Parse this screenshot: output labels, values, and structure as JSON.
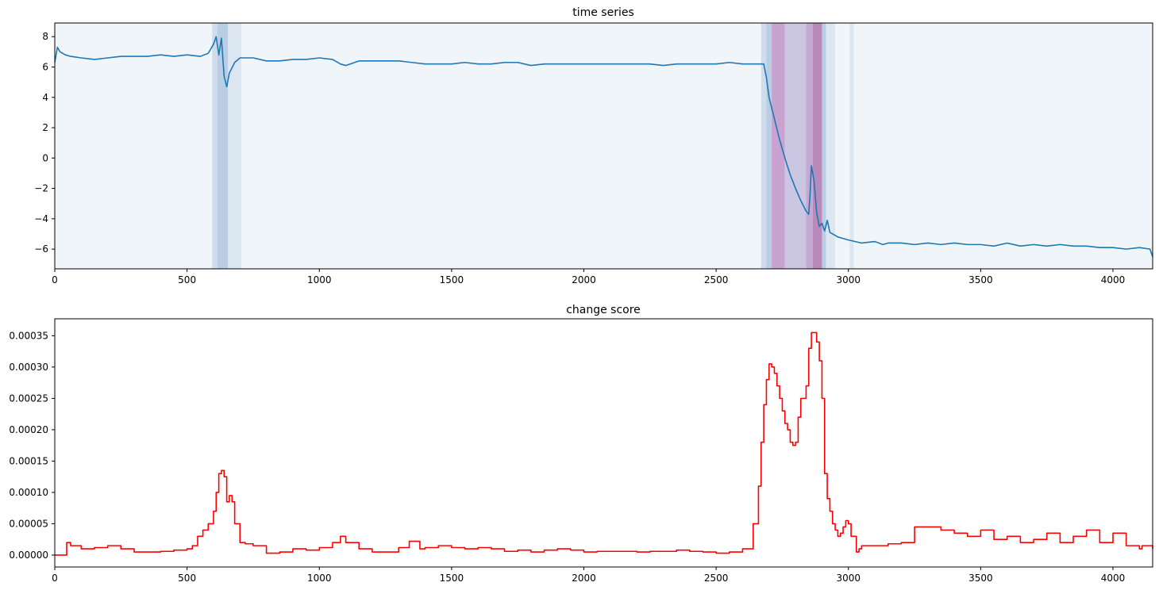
{
  "chart_data": [
    {
      "type": "line",
      "title": "time series",
      "xlabel": "",
      "ylabel": "",
      "xlim": [
        0,
        4150
      ],
      "ylim": [
        -7.3,
        8.9
      ],
      "xticks": [
        0,
        500,
        1000,
        1500,
        2000,
        2500,
        3000,
        3500,
        4000
      ],
      "yticks": [
        -6,
        -4,
        -2,
        0,
        2,
        4,
        6,
        8
      ],
      "grid": false,
      "legend": "none",
      "line_color": "#1f77b4",
      "background_color": "#f0f5fa",
      "shaded_regions": [
        {
          "x0": 595,
          "x1": 615,
          "color": "#cfdcec"
        },
        {
          "x0": 615,
          "x1": 655,
          "color": "#b9cde3"
        },
        {
          "x0": 655,
          "x1": 705,
          "color": "#dbe6f1"
        },
        {
          "x0": 2670,
          "x1": 2690,
          "color": "#cfdcec"
        },
        {
          "x0": 2690,
          "x1": 2710,
          "color": "#b9cde3"
        },
        {
          "x0": 2710,
          "x1": 2760,
          "color": "#c9a3d0"
        },
        {
          "x0": 2760,
          "x1": 2840,
          "color": "#cbc6e1"
        },
        {
          "x0": 2840,
          "x1": 2865,
          "color": "#c4a9d3"
        },
        {
          "x0": 2865,
          "x1": 2900,
          "color": "#b98ab9"
        },
        {
          "x0": 2900,
          "x1": 2915,
          "color": "#b9cde3"
        },
        {
          "x0": 2915,
          "x1": 2950,
          "color": "#dbe6f1"
        },
        {
          "x0": 3005,
          "x1": 3020,
          "color": "#dbe6f1"
        }
      ],
      "x": [
        0,
        10,
        20,
        40,
        60,
        100,
        150,
        200,
        250,
        300,
        350,
        400,
        450,
        500,
        550,
        580,
        600,
        610,
        620,
        630,
        640,
        650,
        660,
        680,
        700,
        750,
        800,
        850,
        900,
        950,
        1000,
        1050,
        1080,
        1100,
        1150,
        1200,
        1250,
        1300,
        1350,
        1400,
        1450,
        1500,
        1550,
        1600,
        1650,
        1700,
        1750,
        1800,
        1850,
        1900,
        1950,
        2000,
        2050,
        2100,
        2150,
        2200,
        2250,
        2300,
        2350,
        2400,
        2450,
        2500,
        2550,
        2600,
        2650,
        2680,
        2690,
        2700,
        2720,
        2740,
        2760,
        2780,
        2800,
        2820,
        2840,
        2850,
        2855,
        2860,
        2870,
        2880,
        2890,
        2900,
        2910,
        2920,
        2930,
        2940,
        2960,
        2980,
        3000,
        3050,
        3100,
        3130,
        3150,
        3200,
        3250,
        3300,
        3350,
        3400,
        3450,
        3500,
        3550,
        3600,
        3650,
        3700,
        3750,
        3800,
        3850,
        3900,
        3950,
        4000,
        4050,
        4100,
        4140,
        4150
      ],
      "y": [
        6.3,
        7.3,
        7.0,
        6.8,
        6.7,
        6.6,
        6.5,
        6.6,
        6.7,
        6.7,
        6.7,
        6.8,
        6.7,
        6.8,
        6.7,
        6.9,
        7.5,
        8.0,
        6.8,
        7.9,
        5.4,
        4.7,
        5.6,
        6.3,
        6.6,
        6.6,
        6.4,
        6.4,
        6.5,
        6.5,
        6.6,
        6.5,
        6.2,
        6.1,
        6.4,
        6.4,
        6.4,
        6.4,
        6.3,
        6.2,
        6.2,
        6.2,
        6.3,
        6.2,
        6.2,
        6.3,
        6.3,
        6.1,
        6.2,
        6.2,
        6.2,
        6.2,
        6.2,
        6.2,
        6.2,
        6.2,
        6.2,
        6.1,
        6.2,
        6.2,
        6.2,
        6.2,
        6.3,
        6.2,
        6.2,
        6.2,
        5.3,
        4.0,
        2.6,
        1.2,
        0.0,
        -1.1,
        -2.0,
        -2.8,
        -3.5,
        -3.7,
        -2.4,
        -0.5,
        -1.5,
        -3.6,
        -4.5,
        -4.3,
        -4.8,
        -4.1,
        -4.9,
        -5.0,
        -5.2,
        -5.3,
        -5.4,
        -5.6,
        -5.5,
        -5.7,
        -5.6,
        -5.6,
        -5.7,
        -5.6,
        -5.7,
        -5.6,
        -5.7,
        -5.7,
        -5.8,
        -5.6,
        -5.8,
        -5.7,
        -5.8,
        -5.7,
        -5.8,
        -5.8,
        -5.9,
        -5.9,
        -6.0,
        -5.9,
        -6.0,
        -6.5
      ]
    },
    {
      "type": "line",
      "title": "change score",
      "xlabel": "",
      "ylabel": "",
      "xlim": [
        0,
        4150
      ],
      "ylim": [
        -1.9e-05,
        0.000377
      ],
      "xticks": [
        0,
        500,
        1000,
        1500,
        2000,
        2500,
        3000,
        3500,
        4000
      ],
      "yticks": [
        0.0,
        5e-05,
        0.0001,
        0.00015,
        0.0002,
        0.00025,
        0.0003,
        0.00035
      ],
      "ytick_labels": [
        "0.00000",
        "0.00005",
        "0.00010",
        "0.00015",
        "0.00020",
        "0.00025",
        "0.00030",
        "0.00035"
      ],
      "grid": false,
      "legend": "none",
      "line_color": "#ff0000",
      "step": true,
      "x": [
        0,
        40,
        45,
        60,
        100,
        150,
        200,
        250,
        300,
        350,
        400,
        450,
        500,
        520,
        540,
        560,
        580,
        600,
        610,
        620,
        630,
        640,
        650,
        660,
        670,
        680,
        700,
        720,
        750,
        800,
        850,
        900,
        950,
        1000,
        1050,
        1080,
        1100,
        1150,
        1200,
        1250,
        1300,
        1340,
        1380,
        1400,
        1450,
        1500,
        1550,
        1600,
        1650,
        1700,
        1750,
        1800,
        1850,
        1900,
        1950,
        2000,
        2050,
        2100,
        2150,
        2200,
        2250,
        2300,
        2350,
        2400,
        2450,
        2500,
        2550,
        2600,
        2640,
        2660,
        2670,
        2680,
        2690,
        2700,
        2710,
        2720,
        2730,
        2740,
        2750,
        2760,
        2770,
        2780,
        2790,
        2800,
        2810,
        2820,
        2830,
        2840,
        2850,
        2860,
        2870,
        2880,
        2890,
        2900,
        2910,
        2920,
        2930,
        2940,
        2950,
        2960,
        2970,
        2980,
        2990,
        3000,
        3010,
        3030,
        3040,
        3050,
        3100,
        3150,
        3200,
        3250,
        3300,
        3350,
        3400,
        3450,
        3500,
        3550,
        3600,
        3650,
        3700,
        3750,
        3800,
        3850,
        3900,
        3950,
        4000,
        4050,
        4100,
        4110,
        4150
      ],
      "y": [
        0.0,
        0.0,
        2e-05,
        1.5e-05,
        1e-05,
        1.2e-05,
        1.5e-05,
        1e-05,
        5e-06,
        5e-06,
        6e-06,
        8e-06,
        1e-05,
        1.5e-05,
        3e-05,
        4e-05,
        5e-05,
        7e-05,
        0.0001,
        0.00013,
        0.000135,
        0.000125,
        8.5e-05,
        9.5e-05,
        8.5e-05,
        5e-05,
        2e-05,
        1.8e-05,
        1.5e-05,
        3e-06,
        5e-06,
        1e-05,
        8e-06,
        1.2e-05,
        2e-05,
        3e-05,
        2e-05,
        1e-05,
        5e-06,
        5e-06,
        1.2e-05,
        2.2e-05,
        1e-05,
        1.2e-05,
        1.5e-05,
        1.2e-05,
        1e-05,
        1.2e-05,
        1e-05,
        6e-06,
        8e-06,
        5e-06,
        8e-06,
        1e-05,
        8e-06,
        5e-06,
        6e-06,
        6e-06,
        6e-06,
        5e-06,
        6e-06,
        6e-06,
        8e-06,
        6e-06,
        5e-06,
        3e-06,
        5e-06,
        1e-05,
        5e-05,
        0.00011,
        0.00018,
        0.00024,
        0.00028,
        0.000305,
        0.0003,
        0.00029,
        0.00027,
        0.00025,
        0.00023,
        0.00021,
        0.0002,
        0.00018,
        0.000175,
        0.00018,
        0.00022,
        0.00025,
        0.00025,
        0.00027,
        0.00033,
        0.000355,
        0.000355,
        0.00034,
        0.00031,
        0.00025,
        0.00013,
        9e-05,
        7e-05,
        5e-05,
        4e-05,
        3e-05,
        3.5e-05,
        4.5e-05,
        5.5e-05,
        5e-05,
        3e-05,
        5e-06,
        1e-05,
        1.5e-05,
        1.5e-05,
        1.8e-05,
        2e-05,
        4.5e-05,
        4.5e-05,
        4e-05,
        3.5e-05,
        3e-05,
        4e-05,
        2.5e-05,
        3e-05,
        2e-05,
        2.5e-05,
        3.5e-05,
        2e-05,
        3e-05,
        4e-05,
        2e-05,
        3.5e-05,
        1.5e-05,
        1e-05,
        1.5e-05,
        1e-05,
        5e-06,
        0.0
      ]
    }
  ]
}
